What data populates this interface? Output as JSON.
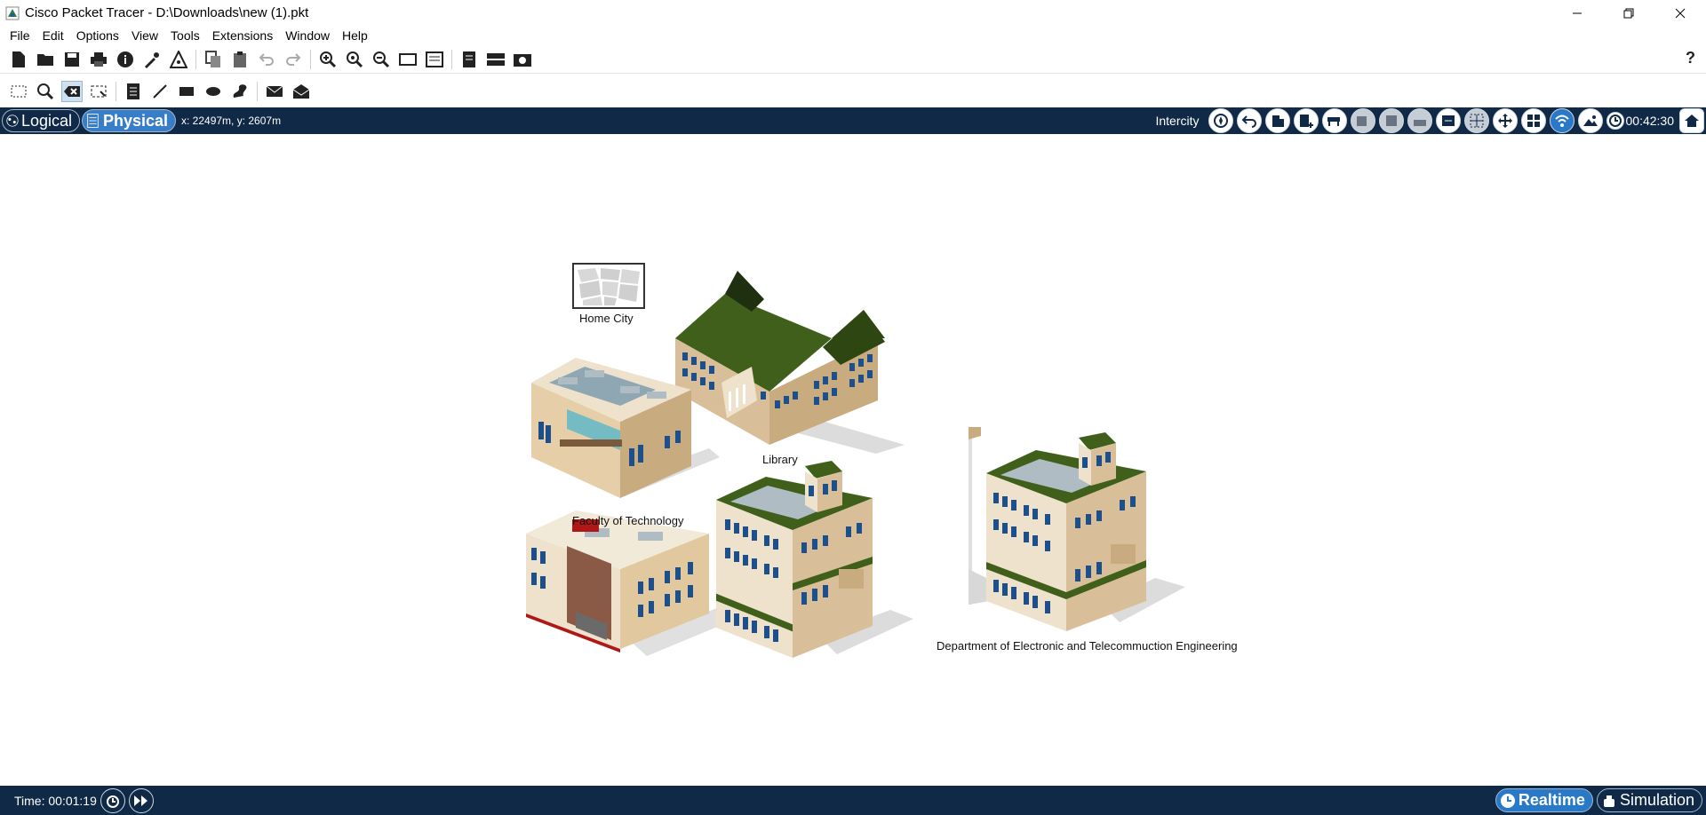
{
  "window": {
    "title": "Cisco Packet Tracer - D:\\Downloads\\new (1).pkt",
    "minimize": "minimize-icon",
    "restore": "restore-icon",
    "close": "close-icon"
  },
  "menu": [
    "File",
    "Edit",
    "Options",
    "View",
    "Tools",
    "Extensions",
    "Window",
    "Help"
  ],
  "toolbar": {
    "help_label": "?"
  },
  "navbar": {
    "logical_label": "Logical",
    "physical_label": "Physical",
    "coords": "x: 22497m, y: 2607m",
    "location_label": "Intercity",
    "clock": "00:42:30"
  },
  "canvas": {
    "home_city_label": "Home City",
    "library_label": "Library",
    "faculty_label": "Faculty of Technology",
    "department_label": "Department of Electronic and Telecommuction Engineering"
  },
  "bottombar": {
    "time_label": "Time: 00:01:19",
    "realtime_label": "Realtime",
    "simulation_label": "Simulation"
  },
  "colors": {
    "navbar_bg": "#0f2946",
    "physical_active": "#3a7dc7",
    "realtime_active": "#2a79c8",
    "building_roof": "#3f5f1a",
    "building_wall": "#d9bf99"
  }
}
